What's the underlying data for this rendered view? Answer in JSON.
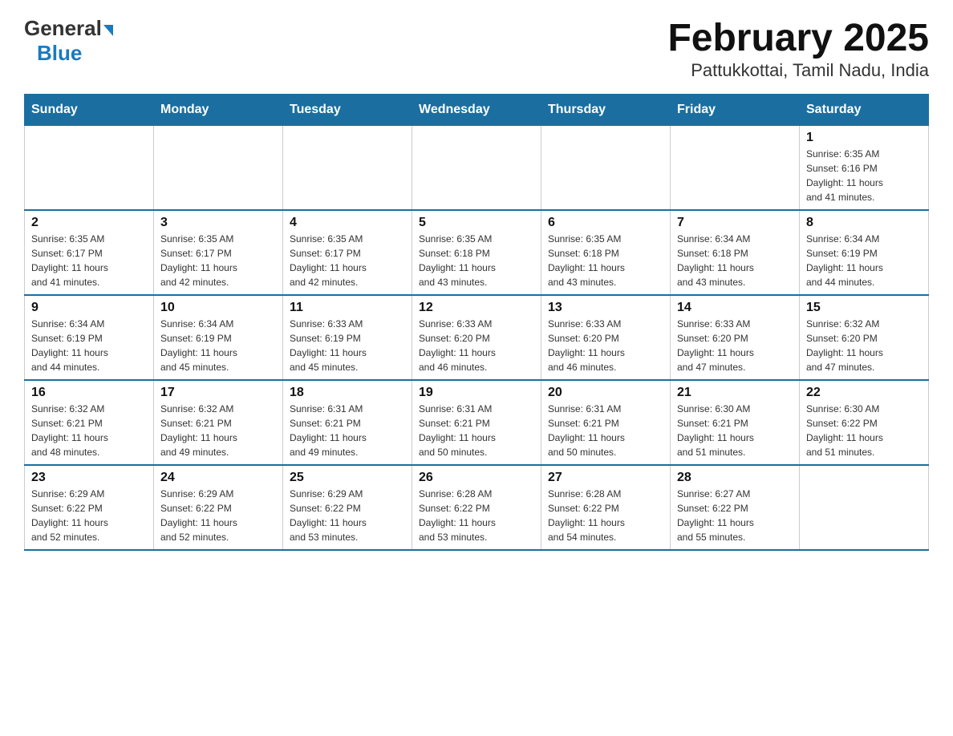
{
  "header": {
    "logo_general": "General",
    "logo_blue": "Blue",
    "title": "February 2025",
    "subtitle": "Pattukkottai, Tamil Nadu, India"
  },
  "weekdays": [
    "Sunday",
    "Monday",
    "Tuesday",
    "Wednesday",
    "Thursday",
    "Friday",
    "Saturday"
  ],
  "weeks": [
    [
      {
        "day": "",
        "info": "",
        "empty": true
      },
      {
        "day": "",
        "info": "",
        "empty": true
      },
      {
        "day": "",
        "info": "",
        "empty": true
      },
      {
        "day": "",
        "info": "",
        "empty": true
      },
      {
        "day": "",
        "info": "",
        "empty": true
      },
      {
        "day": "",
        "info": "",
        "empty": true
      },
      {
        "day": "1",
        "info": "Sunrise: 6:35 AM\nSunset: 6:16 PM\nDaylight: 11 hours\nand 41 minutes.",
        "empty": false
      }
    ],
    [
      {
        "day": "2",
        "info": "Sunrise: 6:35 AM\nSunset: 6:17 PM\nDaylight: 11 hours\nand 41 minutes.",
        "empty": false
      },
      {
        "day": "3",
        "info": "Sunrise: 6:35 AM\nSunset: 6:17 PM\nDaylight: 11 hours\nand 42 minutes.",
        "empty": false
      },
      {
        "day": "4",
        "info": "Sunrise: 6:35 AM\nSunset: 6:17 PM\nDaylight: 11 hours\nand 42 minutes.",
        "empty": false
      },
      {
        "day": "5",
        "info": "Sunrise: 6:35 AM\nSunset: 6:18 PM\nDaylight: 11 hours\nand 43 minutes.",
        "empty": false
      },
      {
        "day": "6",
        "info": "Sunrise: 6:35 AM\nSunset: 6:18 PM\nDaylight: 11 hours\nand 43 minutes.",
        "empty": false
      },
      {
        "day": "7",
        "info": "Sunrise: 6:34 AM\nSunset: 6:18 PM\nDaylight: 11 hours\nand 43 minutes.",
        "empty": false
      },
      {
        "day": "8",
        "info": "Sunrise: 6:34 AM\nSunset: 6:19 PM\nDaylight: 11 hours\nand 44 minutes.",
        "empty": false
      }
    ],
    [
      {
        "day": "9",
        "info": "Sunrise: 6:34 AM\nSunset: 6:19 PM\nDaylight: 11 hours\nand 44 minutes.",
        "empty": false
      },
      {
        "day": "10",
        "info": "Sunrise: 6:34 AM\nSunset: 6:19 PM\nDaylight: 11 hours\nand 45 minutes.",
        "empty": false
      },
      {
        "day": "11",
        "info": "Sunrise: 6:33 AM\nSunset: 6:19 PM\nDaylight: 11 hours\nand 45 minutes.",
        "empty": false
      },
      {
        "day": "12",
        "info": "Sunrise: 6:33 AM\nSunset: 6:20 PM\nDaylight: 11 hours\nand 46 minutes.",
        "empty": false
      },
      {
        "day": "13",
        "info": "Sunrise: 6:33 AM\nSunset: 6:20 PM\nDaylight: 11 hours\nand 46 minutes.",
        "empty": false
      },
      {
        "day": "14",
        "info": "Sunrise: 6:33 AM\nSunset: 6:20 PM\nDaylight: 11 hours\nand 47 minutes.",
        "empty": false
      },
      {
        "day": "15",
        "info": "Sunrise: 6:32 AM\nSunset: 6:20 PM\nDaylight: 11 hours\nand 47 minutes.",
        "empty": false
      }
    ],
    [
      {
        "day": "16",
        "info": "Sunrise: 6:32 AM\nSunset: 6:21 PM\nDaylight: 11 hours\nand 48 minutes.",
        "empty": false
      },
      {
        "day": "17",
        "info": "Sunrise: 6:32 AM\nSunset: 6:21 PM\nDaylight: 11 hours\nand 49 minutes.",
        "empty": false
      },
      {
        "day": "18",
        "info": "Sunrise: 6:31 AM\nSunset: 6:21 PM\nDaylight: 11 hours\nand 49 minutes.",
        "empty": false
      },
      {
        "day": "19",
        "info": "Sunrise: 6:31 AM\nSunset: 6:21 PM\nDaylight: 11 hours\nand 50 minutes.",
        "empty": false
      },
      {
        "day": "20",
        "info": "Sunrise: 6:31 AM\nSunset: 6:21 PM\nDaylight: 11 hours\nand 50 minutes.",
        "empty": false
      },
      {
        "day": "21",
        "info": "Sunrise: 6:30 AM\nSunset: 6:21 PM\nDaylight: 11 hours\nand 51 minutes.",
        "empty": false
      },
      {
        "day": "22",
        "info": "Sunrise: 6:30 AM\nSunset: 6:22 PM\nDaylight: 11 hours\nand 51 minutes.",
        "empty": false
      }
    ],
    [
      {
        "day": "23",
        "info": "Sunrise: 6:29 AM\nSunset: 6:22 PM\nDaylight: 11 hours\nand 52 minutes.",
        "empty": false
      },
      {
        "day": "24",
        "info": "Sunrise: 6:29 AM\nSunset: 6:22 PM\nDaylight: 11 hours\nand 52 minutes.",
        "empty": false
      },
      {
        "day": "25",
        "info": "Sunrise: 6:29 AM\nSunset: 6:22 PM\nDaylight: 11 hours\nand 53 minutes.",
        "empty": false
      },
      {
        "day": "26",
        "info": "Sunrise: 6:28 AM\nSunset: 6:22 PM\nDaylight: 11 hours\nand 53 minutes.",
        "empty": false
      },
      {
        "day": "27",
        "info": "Sunrise: 6:28 AM\nSunset: 6:22 PM\nDaylight: 11 hours\nand 54 minutes.",
        "empty": false
      },
      {
        "day": "28",
        "info": "Sunrise: 6:27 AM\nSunset: 6:22 PM\nDaylight: 11 hours\nand 55 minutes.",
        "empty": false
      },
      {
        "day": "",
        "info": "",
        "empty": true
      }
    ]
  ]
}
